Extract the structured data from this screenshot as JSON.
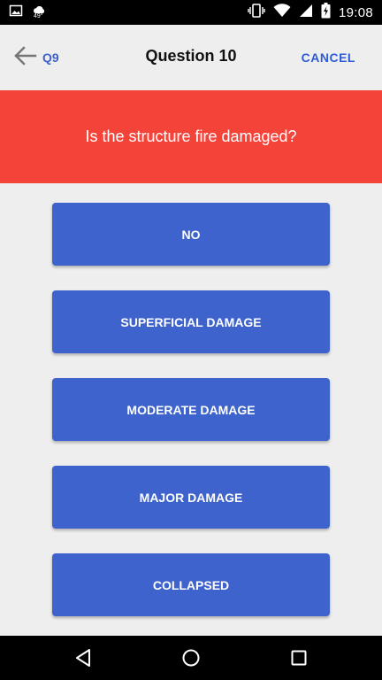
{
  "status_bar": {
    "weather_temp": "49°",
    "time": "19:08",
    "icons": [
      "image-icon",
      "weather-icon",
      "vibrate-icon",
      "wifi-icon",
      "signal-icon",
      "battery-charging-icon"
    ]
  },
  "header": {
    "back_label": "Q9",
    "title": "Question 10",
    "cancel_label": "CANCEL"
  },
  "question": {
    "text": "Is the structure fire damaged?"
  },
  "answers": [
    {
      "label": "NO"
    },
    {
      "label": "SUPERFICIAL DAMAGE"
    },
    {
      "label": "MODERATE DAMAGE"
    },
    {
      "label": "MAJOR DAMAGE"
    },
    {
      "label": "COLLAPSED"
    }
  ],
  "nav_bar": {
    "icons": [
      "back-triangle-icon",
      "home-circle-icon",
      "recents-square-icon"
    ]
  },
  "colors": {
    "banner": "#F4443A",
    "answer_button": "#3E63CC",
    "accent_link": "#2F5BD8",
    "background": "#EEEEEE"
  }
}
